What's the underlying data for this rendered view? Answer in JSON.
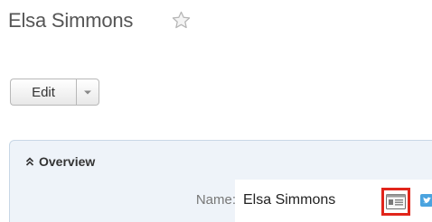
{
  "record": {
    "title": "Elsa Simmons"
  },
  "actions": {
    "edit_label": "Edit"
  },
  "panel": {
    "title": "Overview",
    "fields": {
      "name_label": "Name:",
      "name_value": "Elsa Simmons"
    }
  },
  "icons": {
    "favorite": "star-outline-icon",
    "collapse": "double-chevron-up-icon",
    "vcard": "vcard-icon",
    "social": "twitter-icon",
    "dropdown": "caret-down-icon"
  },
  "colors": {
    "panel_bg": "#eef3f9",
    "panel_border": "#c8d7e6",
    "highlight": "#e1251b",
    "twitter": "#4aa3df"
  }
}
